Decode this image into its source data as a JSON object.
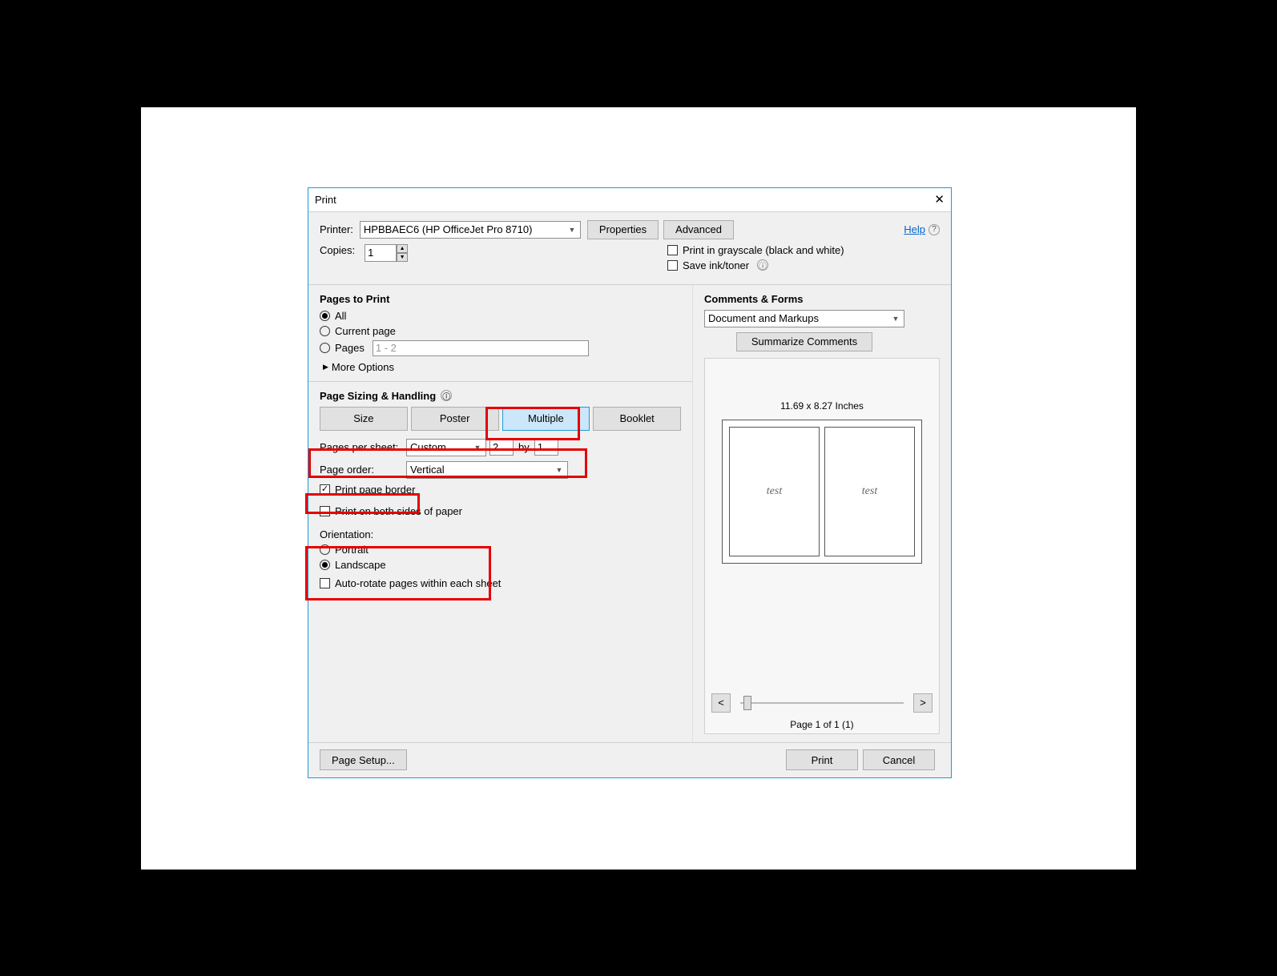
{
  "dialog": {
    "title": "Print",
    "close_glyph": "✕"
  },
  "top": {
    "printer_label": "Printer:",
    "printer_value": "HPBBAEC6 (HP OfficeJet Pro 8710)",
    "properties_btn": "Properties",
    "advanced_btn": "Advanced",
    "help_link": "Help",
    "help_glyph": "?",
    "copies_label": "Copies:",
    "copies_value": "1",
    "grayscale_label": "Print in grayscale (black and white)",
    "saveink_label": "Save ink/toner",
    "info_glyph": "ⓘ"
  },
  "pages_to_print": {
    "title": "Pages to Print",
    "all": "All",
    "current": "Current page",
    "pages_label": "Pages",
    "pages_value": "1 - 2",
    "more": "More Options"
  },
  "sizing": {
    "title": "Page Sizing & Handling",
    "size": "Size",
    "poster": "Poster",
    "multiple": "Multiple",
    "booklet": "Booklet",
    "pps_label": "Pages per sheet:",
    "pps_mode": "Custom...",
    "pps_cols": "2",
    "pps_by": "by",
    "pps_rows": "1",
    "order_label": "Page order:",
    "order_value": "Vertical",
    "border": "Print page border",
    "duplex": "Print on both sides of paper",
    "orientation_label": "Orientation:",
    "portrait": "Portrait",
    "landscape": "Landscape",
    "autorotate": "Auto-rotate pages within each sheet"
  },
  "comments": {
    "title": "Comments & Forms",
    "value": "Document and Markups",
    "summarize": "Summarize Comments"
  },
  "preview": {
    "dimensions": "11.69 x 8.27 Inches",
    "page_text": "test",
    "prev": "<",
    "next": ">",
    "page_of": "Page 1 of 1 (1)"
  },
  "footer": {
    "page_setup": "Page Setup...",
    "print": "Print",
    "cancel": "Cancel"
  }
}
